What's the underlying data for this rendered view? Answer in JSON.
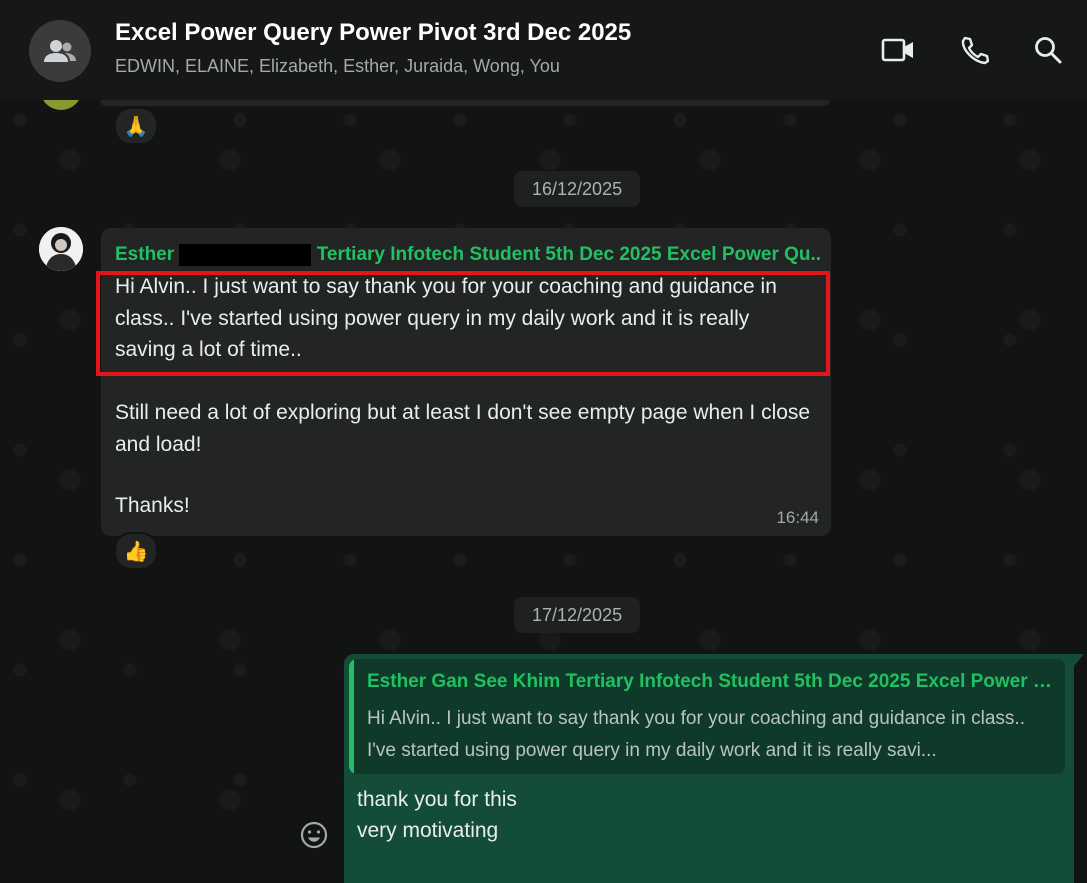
{
  "header": {
    "title": "Excel Power Query Power Pivot 3rd Dec 2025",
    "members": "EDWIN, ELAINE, Elizabeth, Esther, Juraida, Wong, You",
    "icons": [
      "group-icon",
      "video-call-icon",
      "voice-call-icon",
      "search-icon"
    ]
  },
  "chat": {
    "prev_reaction": "🙏",
    "date_1": "16/12/2025",
    "incoming": {
      "sender_first": "Esther",
      "sender_rest": "Tertiary Infotech Student 5th Dec 2025 Excel Power Qu...",
      "paragraph_1": "Hi Alvin.. I just want to say thank you for your coaching and guidance in class.. I've started using power query in my daily work and it is really saving a lot of time..",
      "paragraph_2": "Still need a lot of exploring but at least I don't see empty page when I close and load!",
      "paragraph_3": "Thanks!",
      "time": "16:44",
      "reaction": "👍"
    },
    "date_2": "17/12/2025",
    "outgoing": {
      "quote_name": "Esther Gan See Khim Tertiary Infotech Student 5th Dec 2025 Excel Power Q...",
      "quote_text": "Hi Alvin.. I just want to say thank you for your coaching and guidance in class.. I've started using power query in my daily work and it is really savi...",
      "line_1": "thank you for this",
      "line_2": "very motivating"
    }
  },
  "colors": {
    "accent_green": "#21c063",
    "outgoing_bubble": "#144d37",
    "incoming_bubble": "#232424",
    "highlight_box": "#e0161a"
  }
}
